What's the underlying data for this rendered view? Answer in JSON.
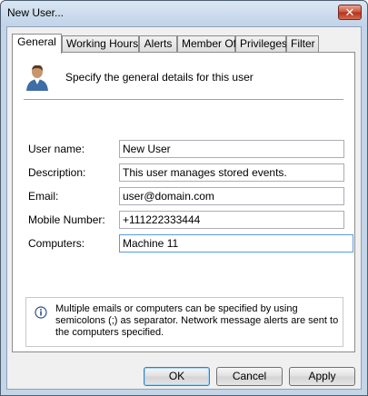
{
  "window": {
    "title": "New User...",
    "close_glyph": "✕"
  },
  "tabs": [
    {
      "label": "General",
      "active": true
    },
    {
      "label": "Working Hours",
      "active": false
    },
    {
      "label": "Alerts",
      "active": false
    },
    {
      "label": "Member Of",
      "active": false
    },
    {
      "label": "Privileges",
      "active": false
    },
    {
      "label": "Filter",
      "active": false
    }
  ],
  "general": {
    "header_icon": "user-icon",
    "header_text": "Specify the general details for this user",
    "fields": [
      {
        "label": "User name:",
        "value": "New User"
      },
      {
        "label": "Description:",
        "value": "This user manages stored events."
      },
      {
        "label": "Email:",
        "value": "user@domain.com"
      },
      {
        "label": "Mobile Number:",
        "value": "+111222333444"
      },
      {
        "label": "Computers:",
        "value": "Machine 11"
      }
    ],
    "info_icon": "info-icon",
    "info_text": "Multiple emails or computers can be specified by using semicolons (;) as separator. Network message alerts are sent to the computers specified."
  },
  "buttons": {
    "ok": "OK",
    "cancel": "Cancel",
    "apply": "Apply"
  }
}
